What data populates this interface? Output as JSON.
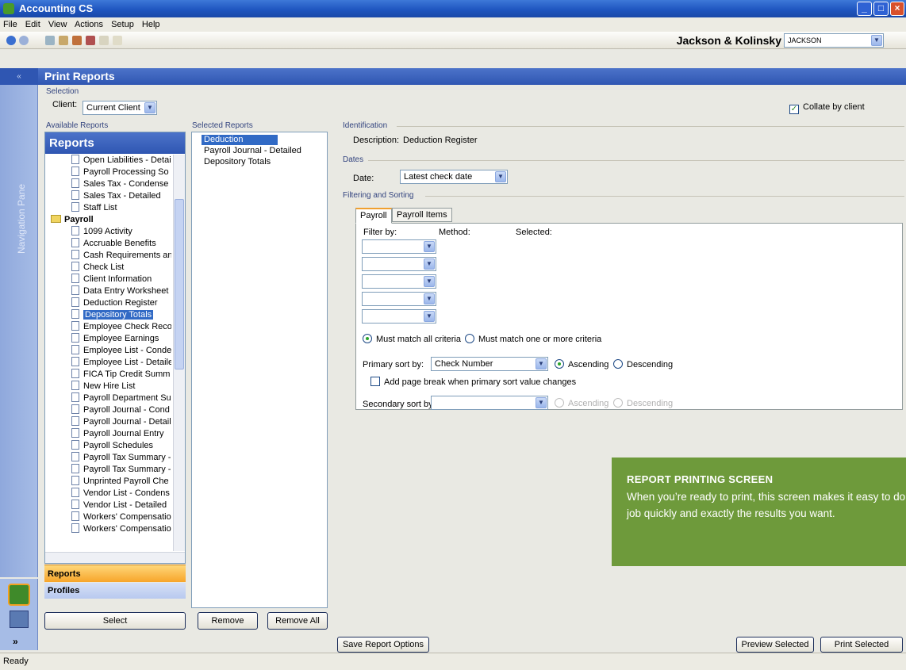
{
  "app": {
    "title": "Accounting CS",
    "menu": [
      "File",
      "Edit",
      "View",
      "Actions",
      "Setup",
      "Help"
    ],
    "company_name": "Jackson & Kolinsky",
    "company_code": "JACKSON"
  },
  "page_title": "Print Reports",
  "selection": {
    "group_label": "Selection",
    "client_label": "Client:",
    "client_value": "Current Client",
    "collate_label": "Collate by client",
    "collate_checked": true
  },
  "available": {
    "label": "Available Reports",
    "header": "Reports",
    "items": [
      {
        "label": "Open Liabilities - Detai",
        "type": "doc"
      },
      {
        "label": "Payroll Processing So",
        "type": "doc"
      },
      {
        "label": "Sales Tax - Condense",
        "type": "doc"
      },
      {
        "label": "Sales Tax - Detailed",
        "type": "doc"
      },
      {
        "label": "Staff List",
        "type": "doc"
      },
      {
        "label": "Payroll",
        "type": "folder"
      },
      {
        "label": "1099 Activity",
        "type": "doc"
      },
      {
        "label": "Accruable Benefits",
        "type": "doc"
      },
      {
        "label": "Cash Requirements an",
        "type": "doc"
      },
      {
        "label": "Check List",
        "type": "doc"
      },
      {
        "label": "Client Information",
        "type": "doc"
      },
      {
        "label": "Data Entry Worksheet",
        "type": "doc"
      },
      {
        "label": "Deduction Register",
        "type": "doc"
      },
      {
        "label": "Depository Totals",
        "type": "doc",
        "selected": true
      },
      {
        "label": "Employee Check Reco",
        "type": "doc"
      },
      {
        "label": "Employee Earnings",
        "type": "doc"
      },
      {
        "label": "Employee List - Conde",
        "type": "doc"
      },
      {
        "label": "Employee List - Detaile",
        "type": "doc"
      },
      {
        "label": "FICA Tip Credit Summ",
        "type": "doc"
      },
      {
        "label": "New Hire List",
        "type": "doc"
      },
      {
        "label": "Payroll Department Su",
        "type": "doc"
      },
      {
        "label": "Payroll Journal - Cond",
        "type": "doc"
      },
      {
        "label": "Payroll Journal - Detail",
        "type": "doc"
      },
      {
        "label": "Payroll Journal Entry",
        "type": "doc"
      },
      {
        "label": "Payroll Schedules",
        "type": "doc"
      },
      {
        "label": "Payroll Tax Summary -",
        "type": "doc"
      },
      {
        "label": "Payroll Tax Summary -",
        "type": "doc"
      },
      {
        "label": "Unprinted Payroll Che",
        "type": "doc"
      },
      {
        "label": "Vendor List - Condens",
        "type": "doc"
      },
      {
        "label": "Vendor List - Detailed",
        "type": "doc"
      },
      {
        "label": "Workers' Compensatio",
        "type": "doc"
      },
      {
        "label": "Workers' Compensatio",
        "type": "doc"
      }
    ],
    "select_button": "Select"
  },
  "nav": {
    "pane_label": "Navigation Pane",
    "sections": [
      "Reports",
      "Profiles"
    ]
  },
  "selected_reports": {
    "label": "Selected Reports",
    "items": [
      "Deduction Register",
      "Payroll Journal - Detailed",
      "Depository Totals"
    ],
    "remove_button": "Remove",
    "remove_all_button": "Remove All"
  },
  "identification": {
    "label": "Identification",
    "description_label": "Description:",
    "description_value": "Deduction Register"
  },
  "dates": {
    "label": "Dates",
    "date_label": "Date:",
    "date_value": "Latest check date"
  },
  "filtering": {
    "label": "Filtering and Sorting",
    "tabs": [
      "Payroll",
      "Payroll Items"
    ],
    "filter_by": "Filter by:",
    "method": "Method:",
    "selected": "Selected:",
    "match_all": "Must match all criteria",
    "match_one": "Must match one or more criteria",
    "primary_sort_label": "Primary sort by:",
    "primary_sort_value": "Check Number",
    "ascending": "Ascending",
    "descending": "Descending",
    "page_break": "Add page break when primary sort value changes",
    "secondary_sort_label": "Secondary sort by:"
  },
  "buttons": {
    "save_options": "Save Report Options",
    "preview": "Preview Selected",
    "print": "Print Selected"
  },
  "callout": {
    "title": "REPORT PRINTING SCREEN",
    "body": "When you’re ready to print, this screen makes it easy to do the job quickly and exactly the results you want."
  },
  "status": "Ready"
}
